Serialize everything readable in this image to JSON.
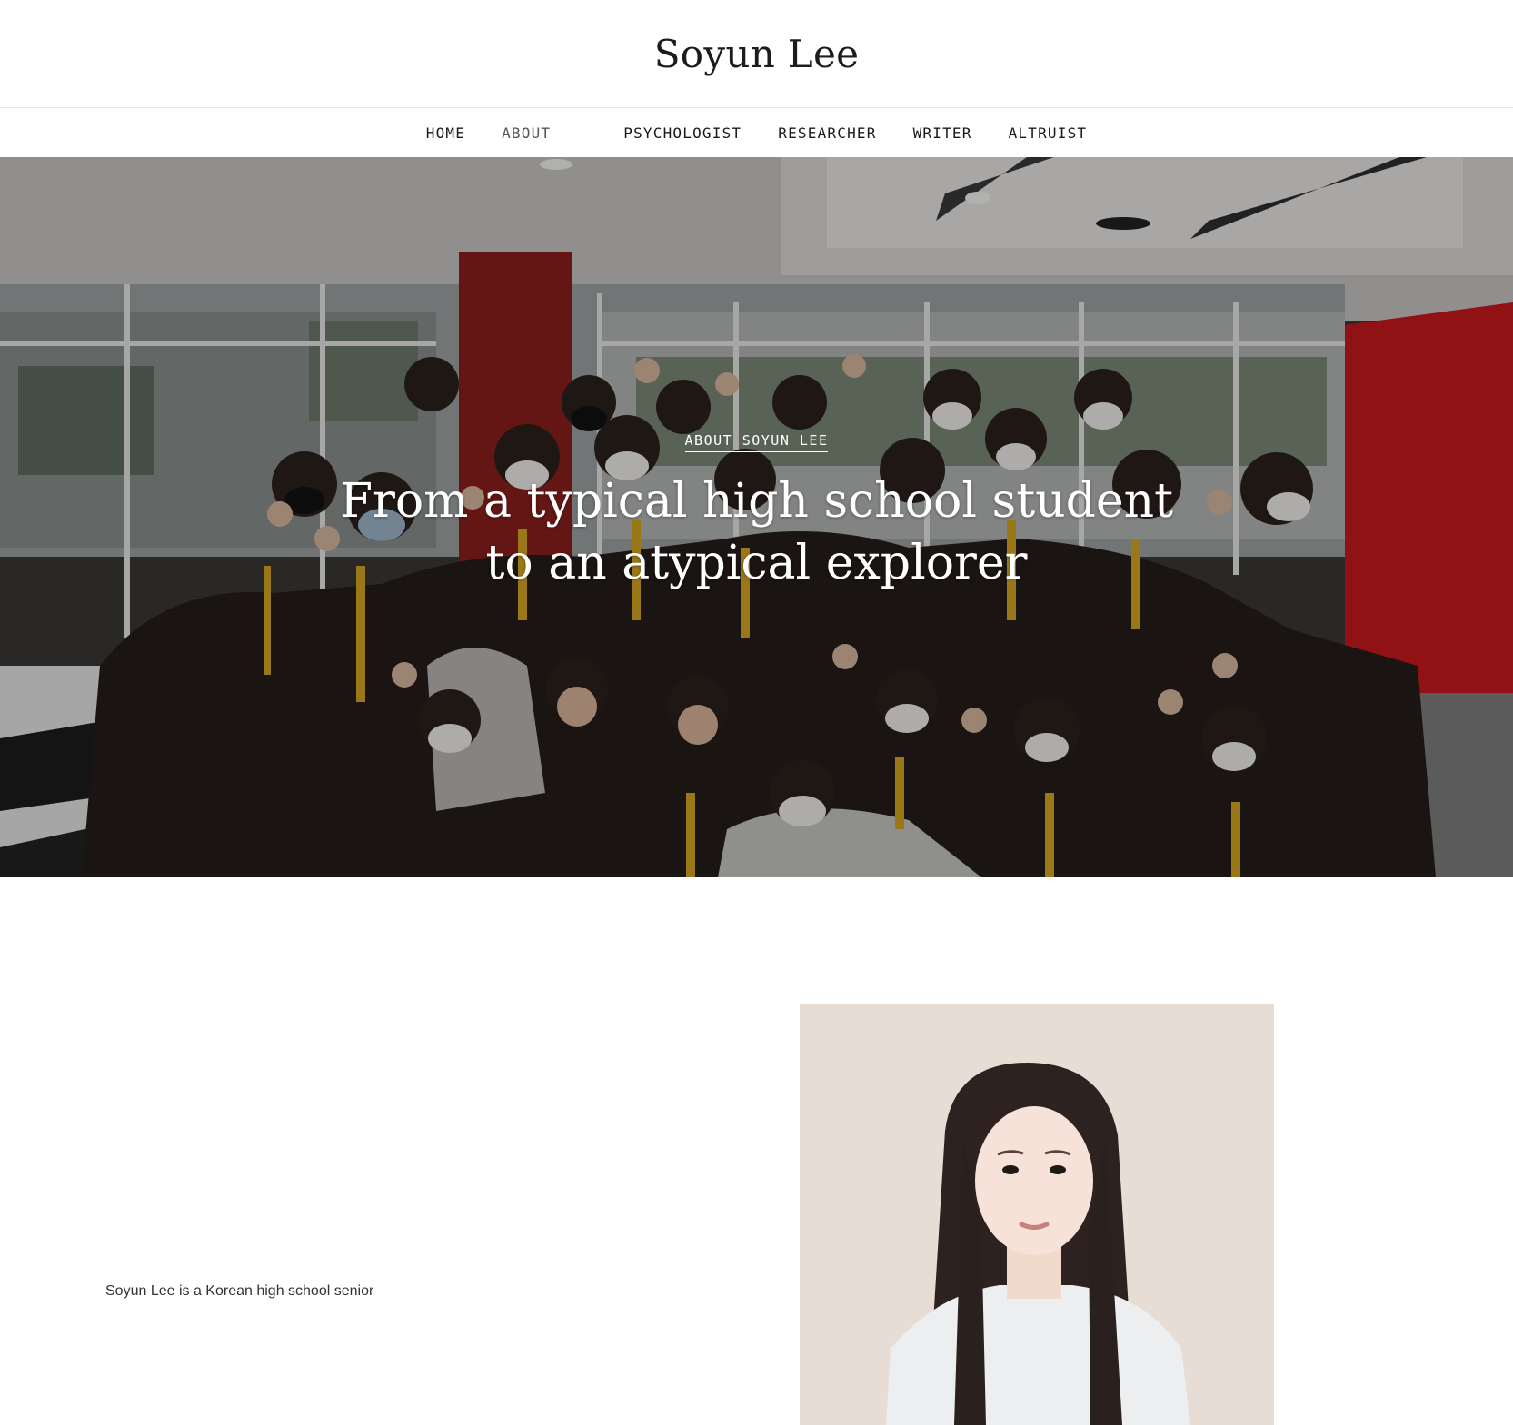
{
  "header": {
    "site_title": "Soyun Lee"
  },
  "nav": {
    "items": [
      {
        "label": "HOME"
      },
      {
        "label": "ABOUT"
      },
      {
        "label": "PSYCHOLOGIST"
      },
      {
        "label": "RESEARCHER"
      },
      {
        "label": "WRITER"
      },
      {
        "label": "ALTRUIST"
      }
    ],
    "current": "ABOUT"
  },
  "hero": {
    "eyebrow": "ABOUT SOYUN LEE",
    "headline_line1": "From a typical high school student",
    "headline_line2": "to an atypical explorer"
  },
  "intro": {
    "text": "Soyun Lee is a Korean high school senior"
  },
  "colors": {
    "wall_red": "#c9191c",
    "portrait_bg": "#e8ddd4",
    "tie_gold": "#d6a521"
  }
}
